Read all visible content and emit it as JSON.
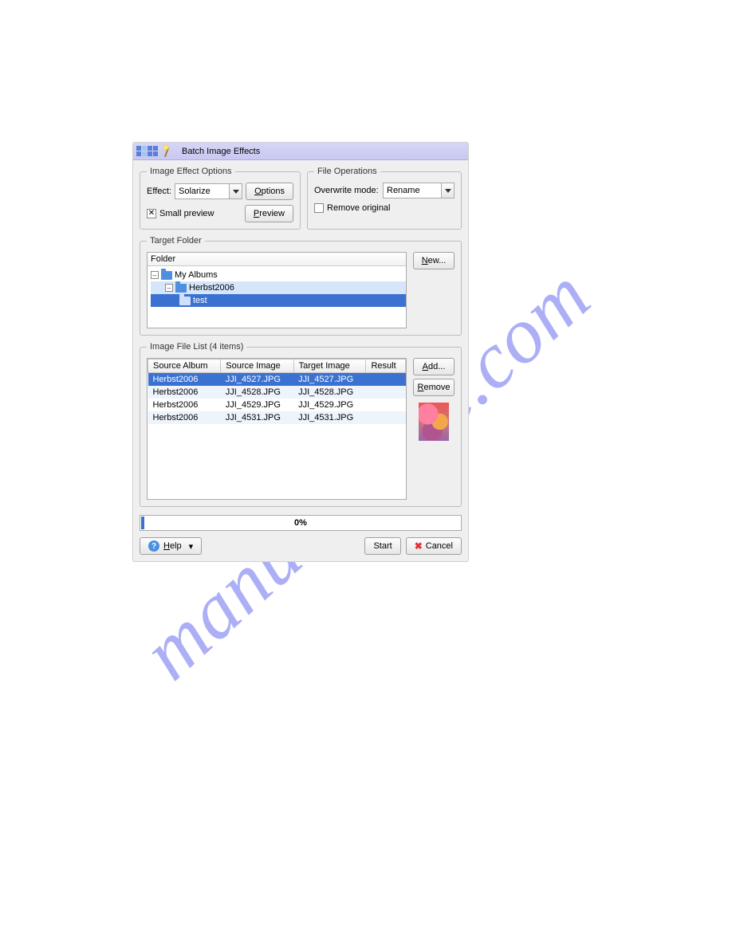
{
  "watermark": "manualshive.com",
  "title": "Batch Image Effects",
  "image_effect_options": {
    "legend": "Image Effect Options",
    "effect_label": "Effect:",
    "effect_value": "Solarize",
    "options_btn": "Options",
    "small_preview_checked": true,
    "small_preview_label": "Small preview",
    "preview_btn": "Preview"
  },
  "file_operations": {
    "legend": "File Operations",
    "overwrite_label": "Overwrite mode:",
    "overwrite_value": "Rename",
    "remove_original_checked": false,
    "remove_original_label": "Remove original"
  },
  "target_folder": {
    "legend": "Target Folder",
    "header": "Folder",
    "new_btn": "New...",
    "tree": {
      "root": "My Albums",
      "child1": "Herbst2006",
      "child2": "test"
    }
  },
  "file_list": {
    "legend": "Image File List (4 items)",
    "columns": {
      "c0": "Source Album",
      "c1": "Source Image",
      "c2": "Target Image",
      "c3": "Result"
    },
    "rows": [
      {
        "album": "Herbst2006",
        "source": "JJI_4527.JPG",
        "target": "JJI_4527.JPG",
        "result": ""
      },
      {
        "album": "Herbst2006",
        "source": "JJI_4528.JPG",
        "target": "JJI_4528.JPG",
        "result": ""
      },
      {
        "album": "Herbst2006",
        "source": "JJI_4529.JPG",
        "target": "JJI_4529.JPG",
        "result": ""
      },
      {
        "album": "Herbst2006",
        "source": "JJI_4531.JPG",
        "target": "JJI_4531.JPG",
        "result": ""
      }
    ],
    "add_btn": "Add...",
    "remove_btn": "Remove"
  },
  "progress": "0%",
  "footer": {
    "help": "Help",
    "start": "Start",
    "cancel": "Cancel"
  }
}
